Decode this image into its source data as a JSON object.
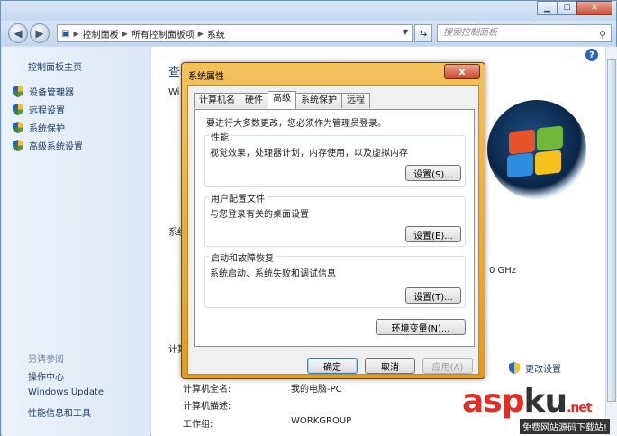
{
  "explorer": {
    "breadcrumbs": [
      "控制面板",
      "所有控制面板项",
      "系统"
    ],
    "search_placeholder": "搜索控制面板",
    "help_glyph": "?",
    "left_pane": {
      "home": "控制面板主页",
      "tasks": [
        "设备管理器",
        "远程设置",
        "系统保护",
        "高级系统设置"
      ],
      "see_also_label": "另请参阅",
      "see_also": [
        "操作中心",
        "Windows Update",
        "性能信息和工具"
      ]
    },
    "main": {
      "title_partial": "查看",
      "windows_partial": "Wi",
      "system_partial": "系统",
      "computer_partial": "计算",
      "cpu_tail": "0 GHz",
      "change_settings": "更改设置",
      "rows": [
        {
          "label": "计算机全名:",
          "value": "我的电脑-PC"
        },
        {
          "label": "计算机描述:",
          "value": ""
        },
        {
          "label": "工作组:",
          "value": "WORKGROUP"
        }
      ]
    }
  },
  "dialog": {
    "title": "系统属性",
    "close_glyph": "x",
    "tabs": [
      "计算机名",
      "硬件",
      "高级",
      "系统保护",
      "远程"
    ],
    "active_tab": "高级",
    "admin_note": "要进行大多数更改，您必须作为管理员登录。",
    "groups": [
      {
        "title": "性能",
        "desc": "视觉效果，处理器计划，内存使用，以及虚拟内存",
        "button": "设置(S)..."
      },
      {
        "title": "用户配置文件",
        "desc": "与您登录有关的桌面设置",
        "button": "设置(E)..."
      },
      {
        "title": "启动和故障恢复",
        "desc": "系统启动、系统失败和调试信息",
        "button": "设置(T)..."
      }
    ],
    "env_button": "环境变量(N)...",
    "ok": "确定",
    "cancel": "取消",
    "apply": "应用(A)"
  },
  "watermark": {
    "asp": "asp",
    "ku": "ku",
    "dotnet": ".net",
    "sub": "免费网站源码下载站!"
  },
  "colors": {
    "dialog_frame": "#e19a24",
    "link": "#1e3a5f",
    "watermark_red": "#e22e24"
  }
}
